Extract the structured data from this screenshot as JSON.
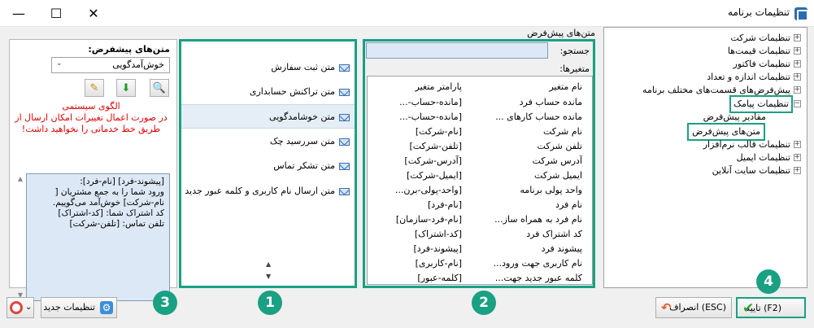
{
  "window": {
    "title": "تنظیمات برنامه",
    "min": "—",
    "max": "☐",
    "close": "✕"
  },
  "tree": {
    "items": [
      {
        "label": "تنظیمات شرکت",
        "expander": "+"
      },
      {
        "label": "تنظیمات قیمت‌ها",
        "expander": "+"
      },
      {
        "label": "تنظیمات فاکتور",
        "expander": "+"
      },
      {
        "label": "تنظیمات اندازه و تعداد",
        "expander": "+"
      },
      {
        "label": "پیش‌فرض‌های قسمت‌های مختلف برنامه",
        "expander": "+"
      },
      {
        "label": "تنظیمات پیامک",
        "expander": "−"
      },
      {
        "label": "مقادیر پیش‌فرض",
        "expander": ""
      },
      {
        "label": "متن‌های پیش‌فرض",
        "expander": ""
      },
      {
        "label": "تنظیمات قالب نرم‌افزار",
        "expander": "+"
      },
      {
        "label": "تنظیمات ایمیل",
        "expander": "+"
      },
      {
        "label": "تنظیمات سایت آنلاین",
        "expander": "+"
      }
    ]
  },
  "vars_panel": {
    "title": "متن‌های پیش‌فرض",
    "search_label": "جستجو:",
    "search_value": "",
    "vars_label": "متغیرها:",
    "header": {
      "name": "نام متغیر",
      "param": "پارامتر متغیر"
    },
    "rows": [
      {
        "name": "مانده حساب فرد",
        "param": "[مانده-حساب-..."
      },
      {
        "name": "مانده حساب کارهای ...",
        "param": "[مانده-حساب-..."
      },
      {
        "name": "نام شرکت",
        "param": "[نام-شرکت]"
      },
      {
        "name": "تلفن شرکت",
        "param": "[تلفن-شرکت]"
      },
      {
        "name": "آدرس شرکت",
        "param": "[آدرس-شرکت]"
      },
      {
        "name": "ایمیل شرکت",
        "param": "[ایمیل-شرکت]"
      },
      {
        "name": "واحد پولی برنامه",
        "param": "[واحد-پولی-برن..."
      },
      {
        "name": "نام فرد",
        "param": "[نام-فرد]"
      },
      {
        "name": "نام فرد به همراه ساز...",
        "param": "[نام-فرد-سازمان]"
      },
      {
        "name": "کد اشتراک فرد",
        "param": "[کد-اشتراک]"
      },
      {
        "name": "پیشوند فرد",
        "param": "[پیشوند-فرد]"
      },
      {
        "name": "نام کاربری جهت ورود...",
        "param": "[نام-کاربری]"
      },
      {
        "name": "کلمه عبور جدید جهت...",
        "param": "[کلمه-عبور]"
      }
    ]
  },
  "messages": {
    "items": [
      {
        "label": "متن ثبت سفارش"
      },
      {
        "label": "متن تراکنش حسابداری"
      },
      {
        "label": "متن خوشامدگویی"
      },
      {
        "label": "متن سررسید چک"
      },
      {
        "label": "متن تشکر تماس"
      },
      {
        "label": "متن ارسال نام کاربری و کلمه عبور جدید"
      }
    ],
    "selected_index": 2,
    "scroll_up": "▲",
    "scroll_down": "▼"
  },
  "editor": {
    "presets_label": "متن‌های پیشفرض:",
    "presets_value": "خوش‌آمدگویی",
    "presets_arrow": "⌄",
    "search_tool": "🔍",
    "add_tool": "⬇",
    "edit_tool": "✎",
    "pattern_title": "الگوی سیستمی",
    "pattern_note": "در صورت اعمال تغییرات امکان ارسال از طریق خط خدماتی را نخواهید داشت!",
    "text": "[پیشوند-فرد] [نام-فرد]:\nورود شما را به جمع مشتریان [\nنام-شرکت] خوش‌آمد می‌گوییم.\nکد اشتراک شما: [کد-اشتراک]\nتلفن تماس: [تلفن-شرکت]",
    "scroll_up": "▲",
    "scroll_down": "▼"
  },
  "bottom": {
    "confirm": "(F2) تایید",
    "cancel": "(ESC) انصراف",
    "new_settings": "تنظیمات جدید",
    "help_arrow": "⌄"
  },
  "badges": [
    "1",
    "2",
    "3",
    "4"
  ],
  "colors": {
    "accent": "#1aa083",
    "warning": "#e00000",
    "selection": "#e5eef7"
  }
}
